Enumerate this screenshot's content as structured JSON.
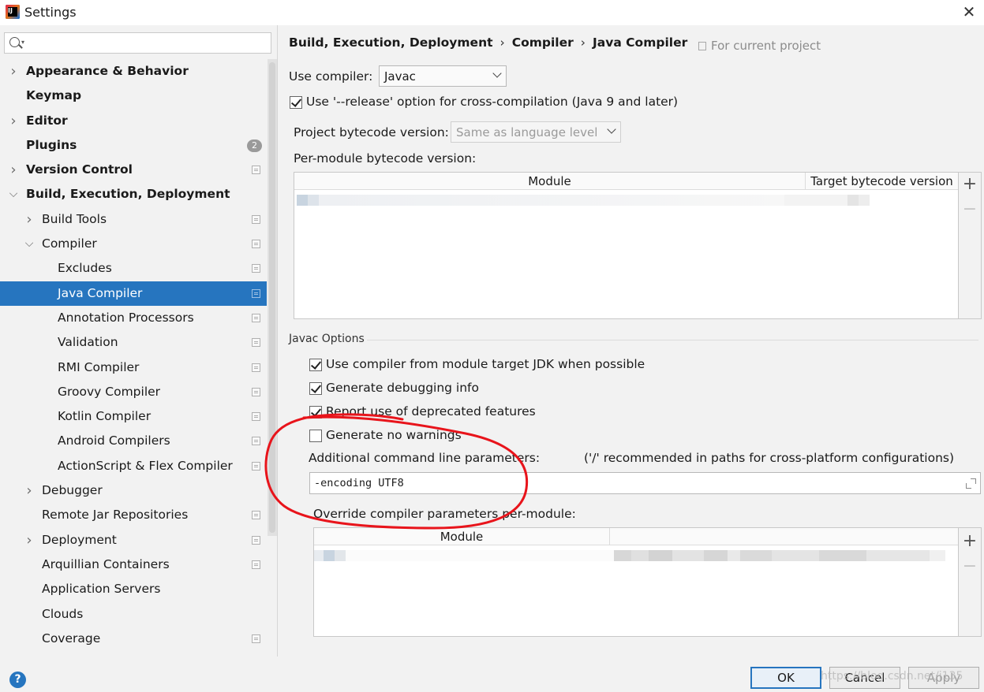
{
  "window": {
    "title": "Settings",
    "app_icon_text": "IJ"
  },
  "sidebar": {
    "search_placeholder": "",
    "items": [
      {
        "label": "Appearance & Behavior",
        "level": 0,
        "arrow": "collapsed",
        "bold": true
      },
      {
        "label": "Keymap",
        "level": 0,
        "arrow": "none",
        "bold": true
      },
      {
        "label": "Editor",
        "level": 0,
        "arrow": "collapsed",
        "bold": true
      },
      {
        "label": "Plugins",
        "level": 0,
        "arrow": "none",
        "bold": true,
        "badge": "2"
      },
      {
        "label": "Version Control",
        "level": 0,
        "arrow": "collapsed",
        "bold": true,
        "project": true
      },
      {
        "label": "Build, Execution, Deployment",
        "level": 0,
        "arrow": "expanded",
        "bold": true
      },
      {
        "label": "Build Tools",
        "level": 1,
        "arrow": "collapsed",
        "project": true
      },
      {
        "label": "Compiler",
        "level": 1,
        "arrow": "expanded",
        "project": true
      },
      {
        "label": "Excludes",
        "level": 2,
        "arrow": "none",
        "project": true
      },
      {
        "label": "Java Compiler",
        "level": 2,
        "arrow": "none",
        "project": true,
        "selected": true
      },
      {
        "label": "Annotation Processors",
        "level": 2,
        "arrow": "none",
        "project": true
      },
      {
        "label": "Validation",
        "level": 2,
        "arrow": "none",
        "project": true
      },
      {
        "label": "RMI Compiler",
        "level": 2,
        "arrow": "none",
        "project": true
      },
      {
        "label": "Groovy Compiler",
        "level": 2,
        "arrow": "none",
        "project": true
      },
      {
        "label": "Kotlin Compiler",
        "level": 2,
        "arrow": "none",
        "project": true
      },
      {
        "label": "Android Compilers",
        "level": 2,
        "arrow": "none",
        "project": true
      },
      {
        "label": "ActionScript & Flex Compiler",
        "level": 2,
        "arrow": "none",
        "project": true
      },
      {
        "label": "Debugger",
        "level": 1,
        "arrow": "collapsed"
      },
      {
        "label": "Remote Jar Repositories",
        "level": 1,
        "arrow": "none",
        "project": true
      },
      {
        "label": "Deployment",
        "level": 1,
        "arrow": "collapsed",
        "project": true
      },
      {
        "label": "Arquillian Containers",
        "level": 1,
        "arrow": "none",
        "project": true
      },
      {
        "label": "Application Servers",
        "level": 1,
        "arrow": "none"
      },
      {
        "label": "Clouds",
        "level": 1,
        "arrow": "none"
      },
      {
        "label": "Coverage",
        "level": 1,
        "arrow": "none",
        "project": true
      }
    ]
  },
  "breadcrumb": {
    "parts": [
      "Build, Execution, Deployment",
      "Compiler",
      "Java Compiler"
    ],
    "separator": "›"
  },
  "for_project": "For current project",
  "compiler": {
    "use_compiler_label": "Use compiler:",
    "use_compiler_value": "Javac",
    "release_option_label": "Use '--release' option for cross-compilation (Java 9 and later)",
    "release_option_checked": true
  },
  "bytecode": {
    "project_label": "Project bytecode version:",
    "project_value": "Same as language level",
    "per_module_label": "Per-module bytecode version:",
    "columns": [
      "Module",
      "Target bytecode version"
    ],
    "add_label": "+",
    "remove_label": "−"
  },
  "javac": {
    "group_title": "Javac Options",
    "options": [
      {
        "label": "Use compiler from module target JDK when possible",
        "checked": true
      },
      {
        "label": "Generate debugging info",
        "checked": true
      },
      {
        "label": "Report use of deprecated features",
        "checked": true
      },
      {
        "label": "Generate no warnings",
        "checked": false
      }
    ],
    "params_label": "Additional command line parameters:",
    "params_hint": "('/' recommended in paths for cross-platform configurations)",
    "params_value": "-encoding UTF8",
    "override_label": "Override compiler parameters per-module:",
    "override_columns": [
      "Module",
      ""
    ],
    "add_label": "+",
    "remove_label": "−"
  },
  "dialog": {
    "ok": "OK",
    "cancel": "Cancel",
    "apply": "Apply",
    "help": "?"
  },
  "watermark": "https://blog.csdn.net/j135",
  "theme": {
    "selection": "#2675bf",
    "annotation": "#e8141b",
    "badge": "#9a9a9a"
  }
}
